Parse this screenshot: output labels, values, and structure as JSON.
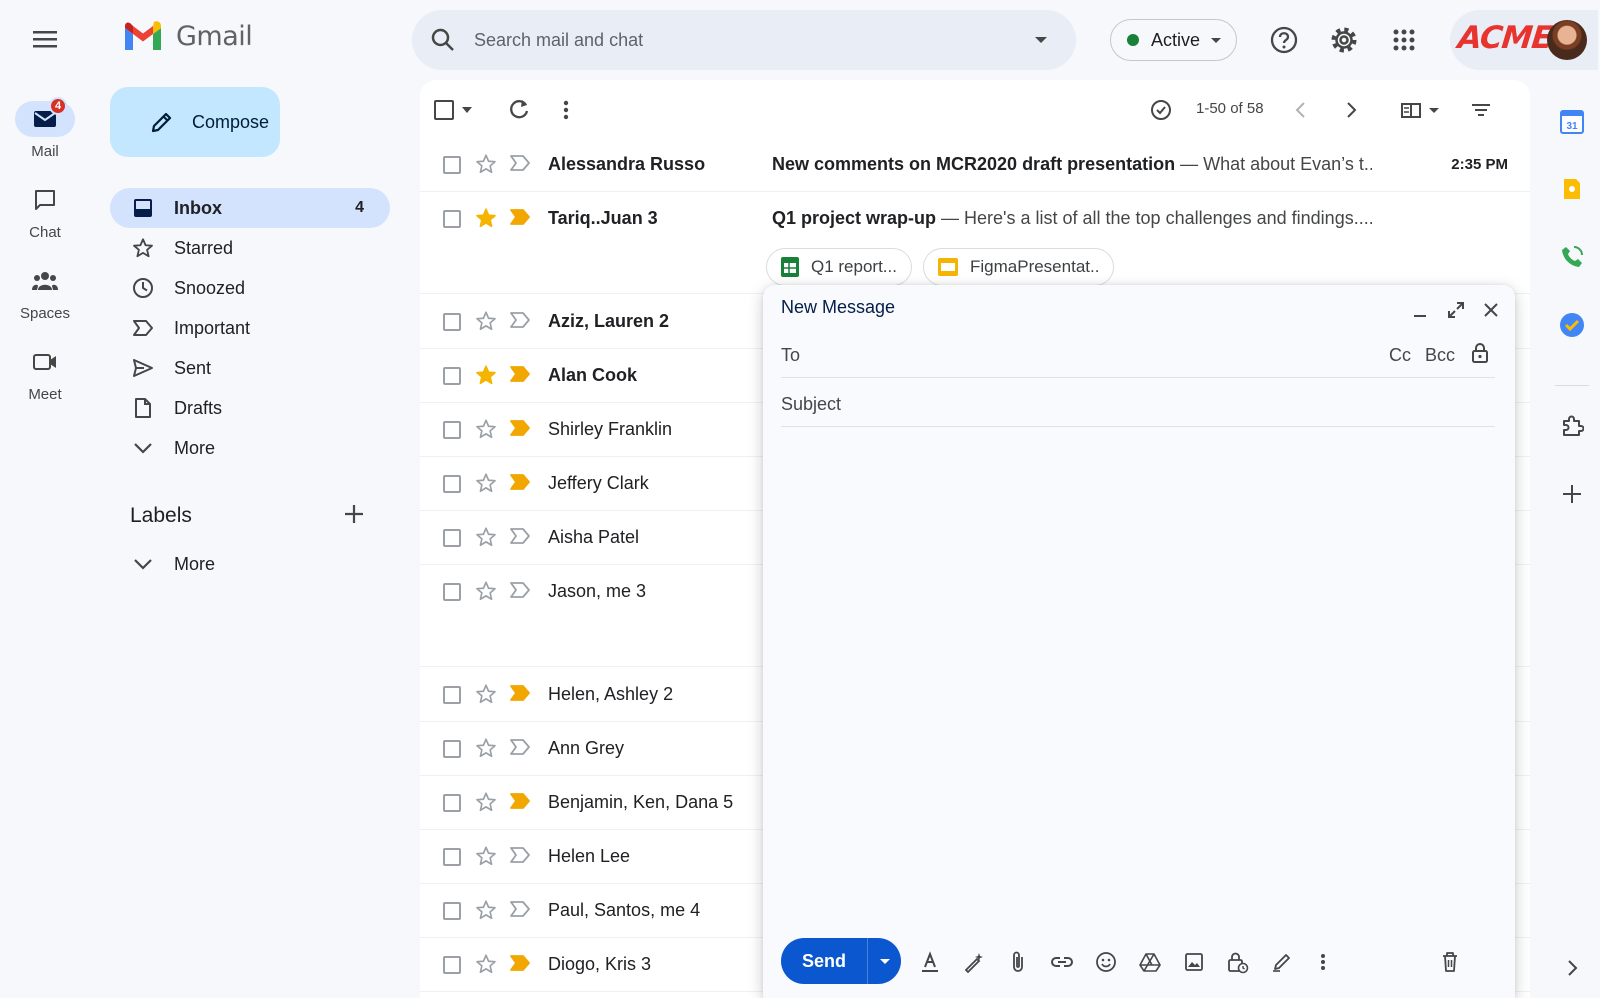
{
  "app": {
    "name": "Gmail",
    "brand_logo": "ACME"
  },
  "colors": {
    "accent": "#0b57d0",
    "active_status": "#188038",
    "important": "#f2a600",
    "star": "#f4b400",
    "badge": "#d93025"
  },
  "rail": {
    "items": [
      {
        "label": "Mail",
        "icon": "mail-icon",
        "badge": "4",
        "active": true
      },
      {
        "label": "Chat",
        "icon": "chat-icon"
      },
      {
        "label": "Spaces",
        "icon": "spaces-icon"
      },
      {
        "label": "Meet",
        "icon": "meet-icon"
      }
    ]
  },
  "search": {
    "placeholder": "Search mail and chat"
  },
  "status": {
    "label": "Active"
  },
  "compose_button": {
    "label": "Compose"
  },
  "nav": {
    "items": [
      {
        "label": "Inbox",
        "count": "4",
        "icon": "inbox-icon",
        "active": true
      },
      {
        "label": "Starred",
        "icon": "star-icon"
      },
      {
        "label": "Snoozed",
        "icon": "clock-icon"
      },
      {
        "label": "Important",
        "icon": "important-icon"
      },
      {
        "label": "Sent",
        "icon": "send-icon"
      },
      {
        "label": "Drafts",
        "icon": "draft-icon"
      },
      {
        "label": "More",
        "icon": "chevron-down-icon"
      }
    ],
    "labels_header": "Labels",
    "labels_more": "More"
  },
  "toolbar": {
    "pagination": "1-50 of 58"
  },
  "emails": [
    {
      "sender": "Alessandra Russo",
      "subject": "New comments on MCR2020 draft presentation",
      "snippet": " — What about Evan’s t...",
      "time": "2:35 PM",
      "unread": true,
      "starred": false,
      "important": false
    },
    {
      "sender": "Tariq..Juan 3",
      "subject": "Q1 project wrap-up",
      "snippet": " — Here's a list of all the top challenges and findings....",
      "time": "",
      "unread": true,
      "starred": true,
      "important": true
    },
    {
      "sender": "Aziz, Lauren 2",
      "unread": true,
      "starred": false,
      "important": false
    },
    {
      "sender": "Alan Cook",
      "unread": true,
      "starred": true,
      "important": true
    },
    {
      "sender": "Shirley Franklin",
      "unread": false,
      "starred": false,
      "important": true
    },
    {
      "sender": "Jeffery Clark",
      "unread": false,
      "starred": false,
      "important": true
    },
    {
      "sender": "Aisha Patel",
      "unread": false,
      "starred": false,
      "important": false
    },
    {
      "sender": "Jason, me 3",
      "unread": false,
      "starred": false,
      "important": false
    },
    {
      "sender": "Helen, Ashley 2",
      "unread": false,
      "starred": false,
      "important": true
    },
    {
      "sender": "Ann Grey",
      "unread": false,
      "starred": false,
      "important": false
    },
    {
      "sender": "Benjamin, Ken, Dana 5",
      "unread": false,
      "starred": false,
      "important": true
    },
    {
      "sender": "Helen Lee",
      "unread": false,
      "starred": false,
      "important": false
    },
    {
      "sender": "Paul, Santos, me 4",
      "unread": false,
      "starred": false,
      "important": false
    },
    {
      "sender": "Diogo, Kris 3",
      "unread": false,
      "starred": false,
      "important": true
    }
  ],
  "attachments": [
    {
      "name": "Q1 report...",
      "icon": "sheets-icon"
    },
    {
      "name": "FigmaPresentat..",
      "icon": "slides-icon"
    }
  ],
  "compose_window": {
    "title": "New Message",
    "to_label": "To",
    "cc_label": "Cc",
    "bcc_label": "Bcc",
    "subject_placeholder": "Subject",
    "send_label": "Send"
  },
  "side_panel": {
    "calendar_day": "31"
  }
}
